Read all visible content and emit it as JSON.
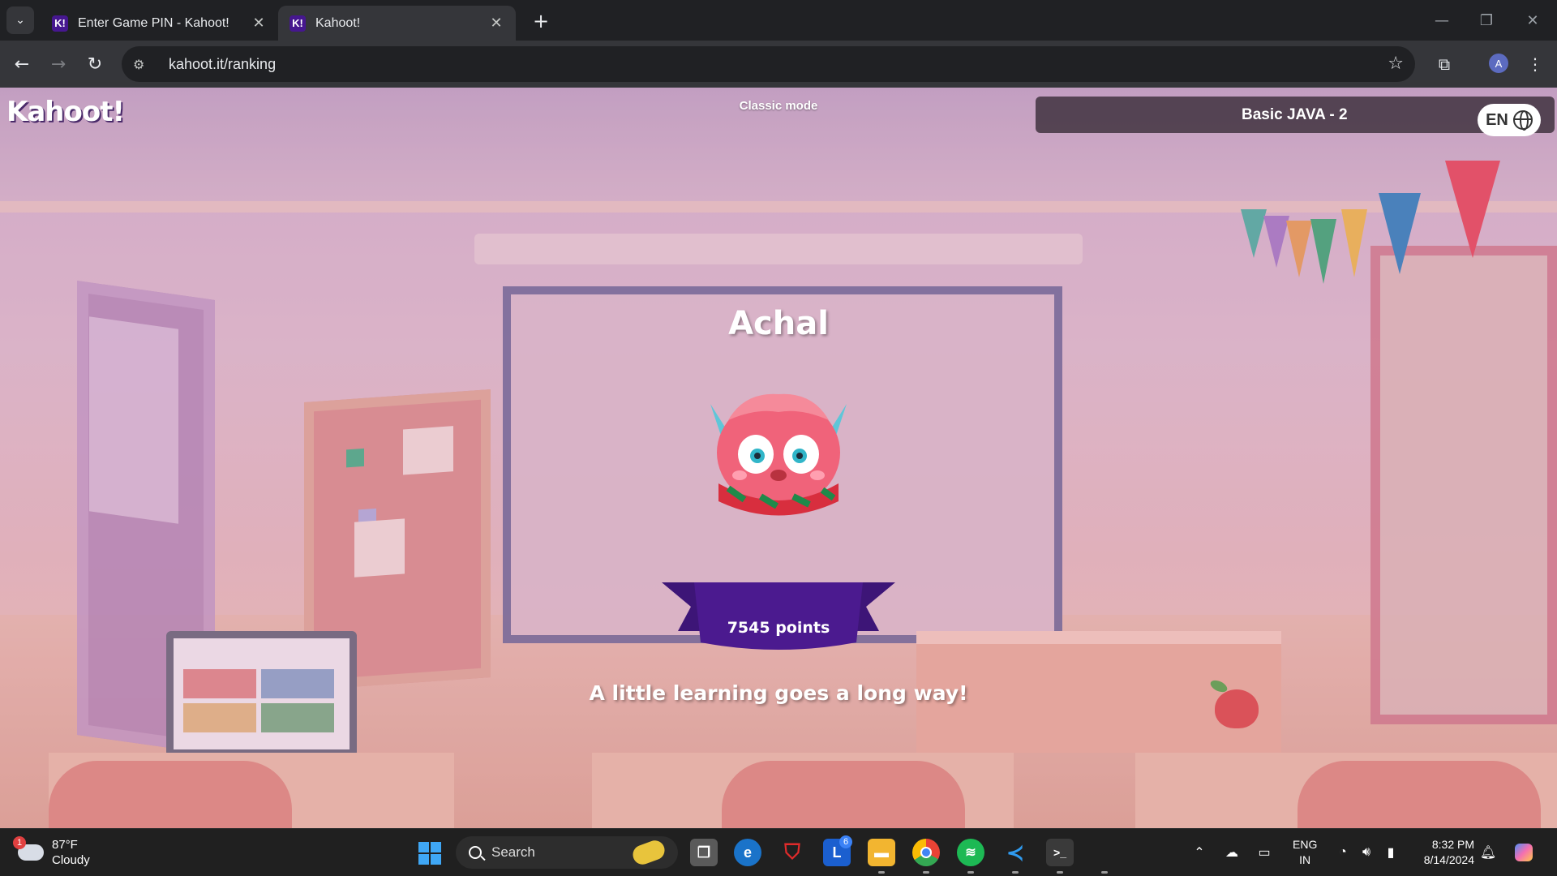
{
  "browser": {
    "tabs": [
      {
        "title": "Enter Game PIN - Kahoot!",
        "favicon": "K!"
      },
      {
        "title": "Kahoot!",
        "favicon": "K!"
      }
    ],
    "url": "kahoot.it/ranking",
    "profile_initial": "A"
  },
  "kahoot": {
    "logo": "Kahoot!",
    "mode": "Classic mode",
    "quiz_title": "Basic JAVA - 2",
    "language": "EN",
    "player_name": "Achal",
    "points_label": "7545 points",
    "motto": "A little learning goes a long way!",
    "points": 7545
  },
  "taskbar": {
    "weather_temp": "87°F",
    "weather_desc": "Cloudy",
    "weather_badge": "1",
    "search_label": "Search",
    "outlook_badge": "6",
    "lang_line1": "ENG",
    "lang_line2": "IN",
    "time": "8:32 PM",
    "date": "8/14/2024"
  },
  "colors": {
    "kahoot_purple": "#46178f",
    "ribbon_purple": "#4b1a8f",
    "browser_bg": "#202124",
    "toolbar_bg": "#35363a",
    "taskbar_bg": "#202020"
  }
}
